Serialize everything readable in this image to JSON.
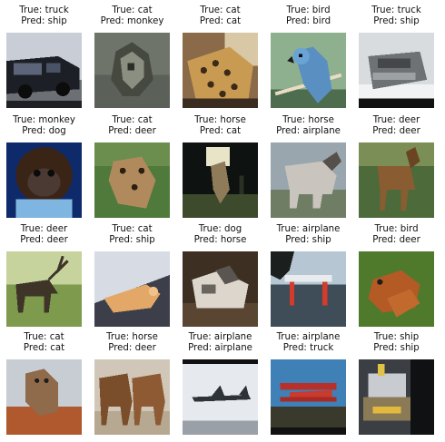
{
  "grid": {
    "rows": 4,
    "cols": 5,
    "true_prefix": "True: ",
    "pred_prefix": "Pred: "
  },
  "samples": [
    {
      "true": "truck",
      "pred": "ship",
      "scene": "car-dark"
    },
    {
      "true": "cat",
      "pred": "monkey",
      "scene": "gray-blob"
    },
    {
      "true": "cat",
      "pred": "cat",
      "scene": "leopard"
    },
    {
      "true": "bird",
      "pred": "bird",
      "scene": "parrot"
    },
    {
      "true": "truck",
      "pred": "ship",
      "scene": "gray-vehicle"
    },
    {
      "true": "monkey",
      "pred": "dog",
      "scene": "monkey-face"
    },
    {
      "true": "cat",
      "pred": "deer",
      "scene": "cat-grass"
    },
    {
      "true": "horse",
      "pred": "cat",
      "scene": "horse-dark"
    },
    {
      "true": "horse",
      "pred": "airplane",
      "scene": "horse-gray"
    },
    {
      "true": "deer",
      "pred": "deer",
      "scene": "deer-brown"
    },
    {
      "true": "deer",
      "pred": "deer",
      "scene": "elk-field"
    },
    {
      "true": "cat",
      "pred": "ship",
      "scene": "cat-lying"
    },
    {
      "true": "dog",
      "pred": "horse",
      "scene": "husky"
    },
    {
      "true": "airplane",
      "pred": "ship",
      "scene": "dock"
    },
    {
      "true": "bird",
      "pred": "deer",
      "scene": "hen"
    },
    {
      "true": "cat",
      "pred": "cat",
      "scene": "cat-rock"
    },
    {
      "true": "horse",
      "pred": "deer",
      "scene": "horses-pair"
    },
    {
      "true": "airplane",
      "pred": "airplane",
      "scene": "jet"
    },
    {
      "true": "airplane",
      "pred": "truck",
      "scene": "red-plane"
    },
    {
      "true": "ship",
      "pred": "ship",
      "scene": "ship-dark"
    }
  ]
}
